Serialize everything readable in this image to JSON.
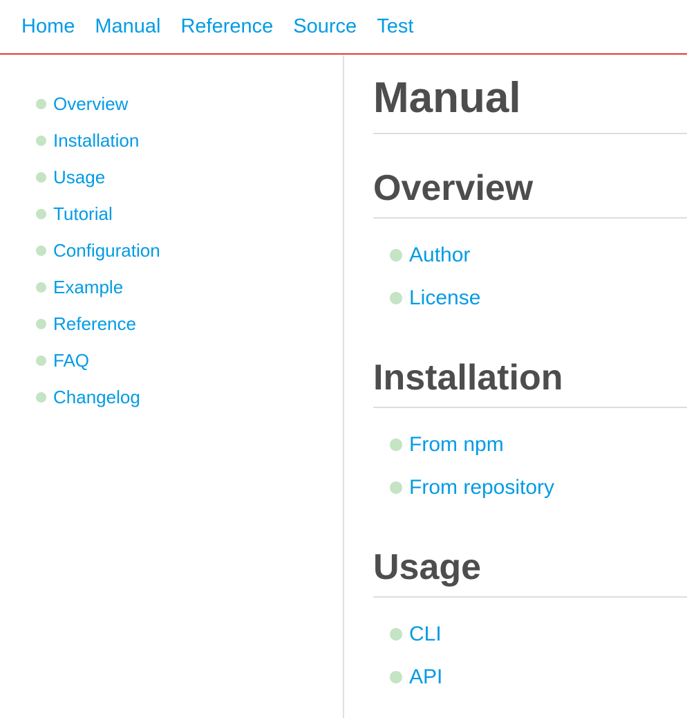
{
  "nav": {
    "items": [
      "Home",
      "Manual",
      "Reference",
      "Source",
      "Test"
    ]
  },
  "sidebar": {
    "items": [
      "Overview",
      "Installation",
      "Usage",
      "Tutorial",
      "Configuration",
      "Example",
      "Reference",
      "FAQ",
      "Changelog"
    ]
  },
  "main": {
    "title": "Manual",
    "sections": [
      {
        "title": "Overview",
        "items": [
          "Author",
          "License"
        ]
      },
      {
        "title": "Installation",
        "items": [
          "From npm",
          "From repository"
        ]
      },
      {
        "title": "Usage",
        "items": [
          "CLI",
          "API"
        ]
      }
    ]
  },
  "colors": {
    "link": "#039be5",
    "nav_border": "#e53935",
    "bullet": "#c4e4c4",
    "heading": "#4d4d4d"
  }
}
